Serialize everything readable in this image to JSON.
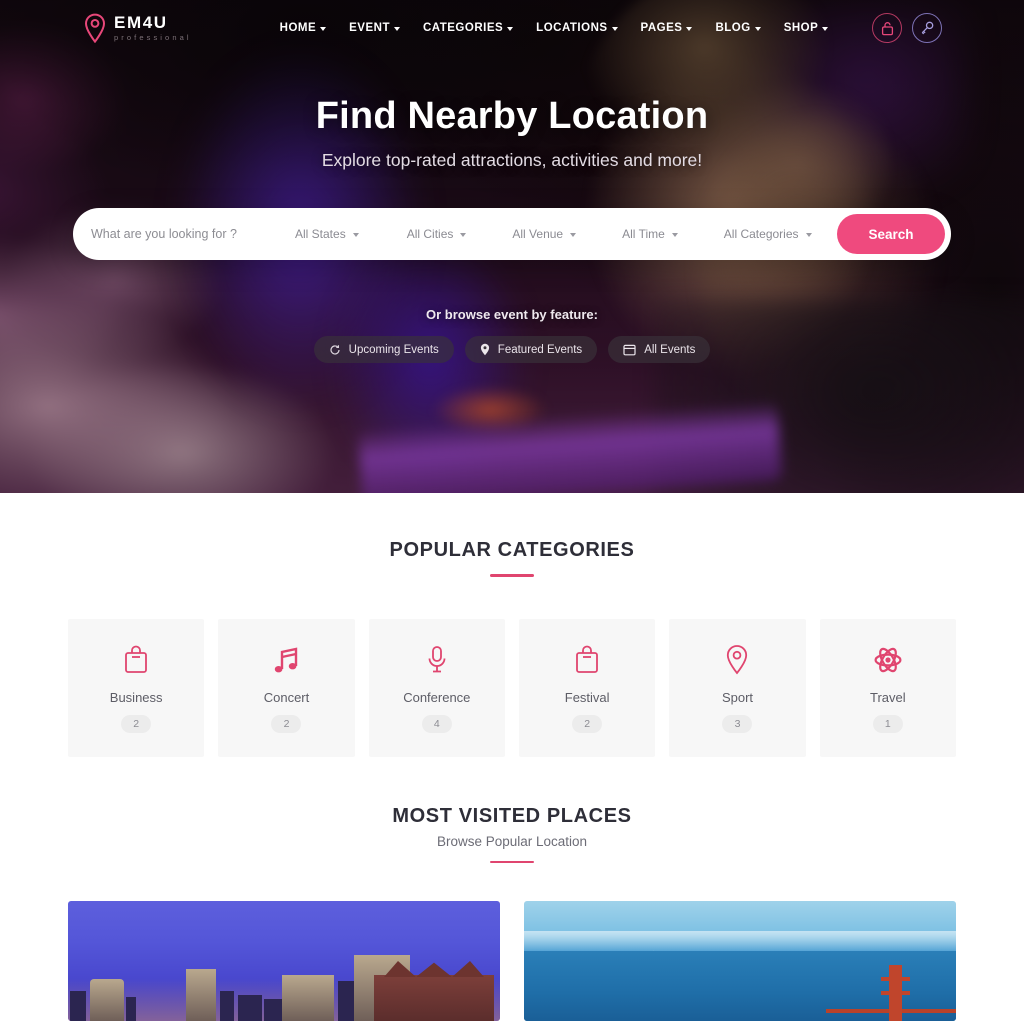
{
  "header": {
    "logo": {
      "title": "EM4U",
      "subtitle": "professional",
      "icon": "map-pin-icon"
    },
    "nav": [
      {
        "label": "HOME",
        "has_dropdown": true
      },
      {
        "label": "EVENT",
        "has_dropdown": true
      },
      {
        "label": "CATEGORIES",
        "has_dropdown": true
      },
      {
        "label": "LOCATIONS",
        "has_dropdown": true
      },
      {
        "label": "PAGES",
        "has_dropdown": true
      },
      {
        "label": "BLOG",
        "has_dropdown": true
      },
      {
        "label": "SHOP",
        "has_dropdown": true
      }
    ],
    "actions": [
      {
        "name": "lock-icon",
        "color": "#e84a78"
      },
      {
        "name": "key-icon",
        "color": "#968cdc"
      }
    ]
  },
  "hero": {
    "title": "Find Nearby Location",
    "subtitle": "Explore top-rated attractions, activities and more!",
    "browse_label": "Or browse event by feature:",
    "chips": [
      {
        "label": "Upcoming Events",
        "icon": "refresh-icon"
      },
      {
        "label": "Featured Events",
        "icon": "map-pin-icon"
      },
      {
        "label": "All Events",
        "icon": "window-icon"
      }
    ]
  },
  "search": {
    "placeholder": "What are you looking for ?",
    "value": "",
    "filters": [
      {
        "label": "All States"
      },
      {
        "label": "All Cities"
      },
      {
        "label": "All Venue"
      },
      {
        "label": "All Time"
      },
      {
        "label": "All Categories"
      }
    ],
    "button_label": "Search"
  },
  "categories_section": {
    "title": "POPULAR CATEGORIES",
    "items": [
      {
        "name": "Business",
        "count": "2",
        "icon": "briefcase-icon"
      },
      {
        "name": "Concert",
        "count": "2",
        "icon": "music-note-icon"
      },
      {
        "name": "Conference",
        "count": "4",
        "icon": "microphone-icon"
      },
      {
        "name": "Festival",
        "count": "2",
        "icon": "briefcase-icon"
      },
      {
        "name": "Sport",
        "count": "3",
        "icon": "map-pin-icon"
      },
      {
        "name": "Travel",
        "count": "1",
        "icon": "atom-icon"
      }
    ]
  },
  "places_section": {
    "title": "MOST VISITED PLACES",
    "subtitle": "Browse Popular Location",
    "cards": [
      {
        "name": "city-skyline-dusk"
      },
      {
        "name": "san-francisco-bay"
      }
    ]
  },
  "colors": {
    "accent_pink": "#ef4a7e",
    "rule_pink": "#e0456f",
    "heading_dark": "#2e2e38",
    "card_bg": "#f7f7f7"
  }
}
